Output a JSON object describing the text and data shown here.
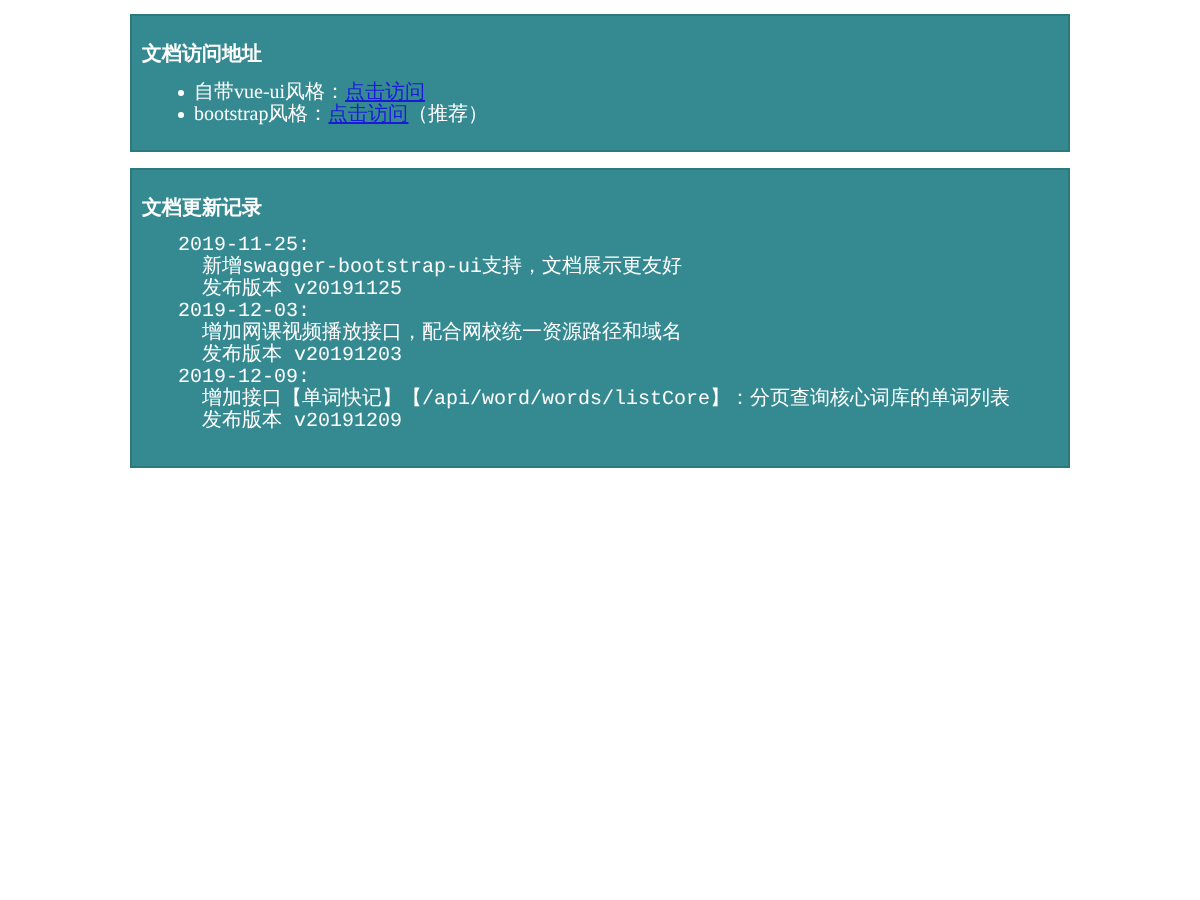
{
  "access_panel": {
    "title": "文档访问地址",
    "items": [
      {
        "label": "自带vue-ui风格：",
        "link": "点击访问"
      },
      {
        "label": "bootstrap风格：",
        "link": "点击访问",
        "note": "（推荐）"
      }
    ]
  },
  "changelog_panel": {
    "title": "文档更新记录",
    "entries": [
      {
        "date": "2019-11-25:",
        "lines": [
          "新增swagger-bootstrap-ui支持，文档展示更友好",
          "发布版本 v20191125"
        ]
      },
      {
        "date": "2019-12-03:",
        "lines": [
          "增加网课视频播放接口，配合网校统一资源路径和域名",
          "发布版本 v20191203"
        ]
      },
      {
        "date": "2019-12-09:",
        "lines": [
          "增加接口【单词快记】【/api/word/words/listCore】：分页查询核心词库的单词列表",
          "发布版本 v20191209"
        ]
      }
    ]
  }
}
